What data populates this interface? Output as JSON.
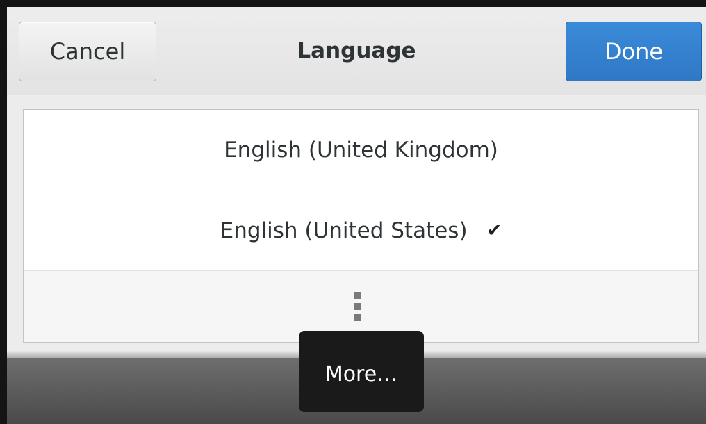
{
  "header": {
    "cancel_label": "Cancel",
    "title": "Language",
    "done_label": "Done"
  },
  "languages": [
    {
      "label": "English (United Kingdom)",
      "selected": false
    },
    {
      "label": "English (United States)",
      "selected": true
    }
  ],
  "more_row": {
    "icon": "vertical-ellipsis-icon"
  },
  "tooltip": {
    "text": "More…"
  },
  "icons": {
    "selected_check": "✔"
  },
  "colors": {
    "accent": "#2f78c6",
    "tooltip_bg": "#1a1a1a"
  }
}
